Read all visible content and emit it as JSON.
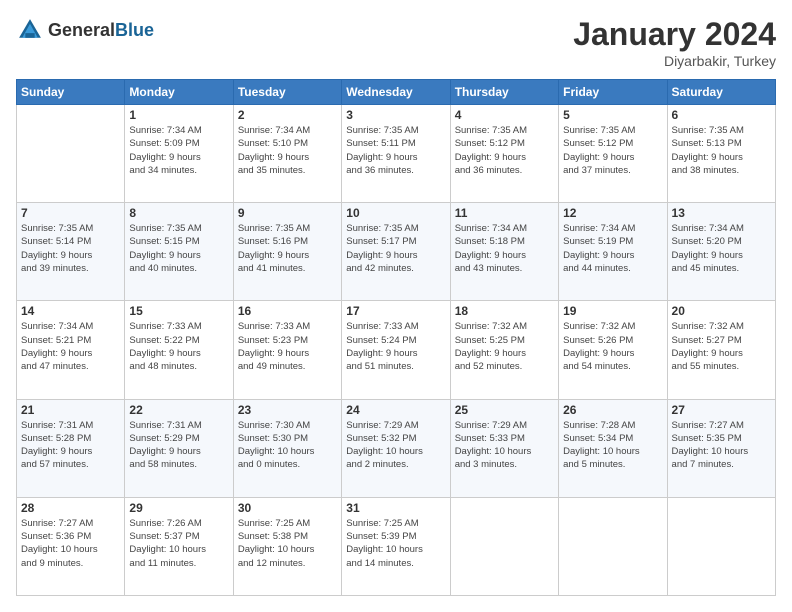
{
  "header": {
    "logo_general": "General",
    "logo_blue": "Blue",
    "month": "January 2024",
    "location": "Diyarbakir, Turkey"
  },
  "weekdays": [
    "Sunday",
    "Monday",
    "Tuesday",
    "Wednesday",
    "Thursday",
    "Friday",
    "Saturday"
  ],
  "weeks": [
    [
      {
        "day": "",
        "info": ""
      },
      {
        "day": "1",
        "info": "Sunrise: 7:34 AM\nSunset: 5:09 PM\nDaylight: 9 hours\nand 34 minutes."
      },
      {
        "day": "2",
        "info": "Sunrise: 7:34 AM\nSunset: 5:10 PM\nDaylight: 9 hours\nand 35 minutes."
      },
      {
        "day": "3",
        "info": "Sunrise: 7:35 AM\nSunset: 5:11 PM\nDaylight: 9 hours\nand 36 minutes."
      },
      {
        "day": "4",
        "info": "Sunrise: 7:35 AM\nSunset: 5:12 PM\nDaylight: 9 hours\nand 36 minutes."
      },
      {
        "day": "5",
        "info": "Sunrise: 7:35 AM\nSunset: 5:12 PM\nDaylight: 9 hours\nand 37 minutes."
      },
      {
        "day": "6",
        "info": "Sunrise: 7:35 AM\nSunset: 5:13 PM\nDaylight: 9 hours\nand 38 minutes."
      }
    ],
    [
      {
        "day": "7",
        "info": "Sunrise: 7:35 AM\nSunset: 5:14 PM\nDaylight: 9 hours\nand 39 minutes."
      },
      {
        "day": "8",
        "info": "Sunrise: 7:35 AM\nSunset: 5:15 PM\nDaylight: 9 hours\nand 40 minutes."
      },
      {
        "day": "9",
        "info": "Sunrise: 7:35 AM\nSunset: 5:16 PM\nDaylight: 9 hours\nand 41 minutes."
      },
      {
        "day": "10",
        "info": "Sunrise: 7:35 AM\nSunset: 5:17 PM\nDaylight: 9 hours\nand 42 minutes."
      },
      {
        "day": "11",
        "info": "Sunrise: 7:34 AM\nSunset: 5:18 PM\nDaylight: 9 hours\nand 43 minutes."
      },
      {
        "day": "12",
        "info": "Sunrise: 7:34 AM\nSunset: 5:19 PM\nDaylight: 9 hours\nand 44 minutes."
      },
      {
        "day": "13",
        "info": "Sunrise: 7:34 AM\nSunset: 5:20 PM\nDaylight: 9 hours\nand 45 minutes."
      }
    ],
    [
      {
        "day": "14",
        "info": "Sunrise: 7:34 AM\nSunset: 5:21 PM\nDaylight: 9 hours\nand 47 minutes."
      },
      {
        "day": "15",
        "info": "Sunrise: 7:33 AM\nSunset: 5:22 PM\nDaylight: 9 hours\nand 48 minutes."
      },
      {
        "day": "16",
        "info": "Sunrise: 7:33 AM\nSunset: 5:23 PM\nDaylight: 9 hours\nand 49 minutes."
      },
      {
        "day": "17",
        "info": "Sunrise: 7:33 AM\nSunset: 5:24 PM\nDaylight: 9 hours\nand 51 minutes."
      },
      {
        "day": "18",
        "info": "Sunrise: 7:32 AM\nSunset: 5:25 PM\nDaylight: 9 hours\nand 52 minutes."
      },
      {
        "day": "19",
        "info": "Sunrise: 7:32 AM\nSunset: 5:26 PM\nDaylight: 9 hours\nand 54 minutes."
      },
      {
        "day": "20",
        "info": "Sunrise: 7:32 AM\nSunset: 5:27 PM\nDaylight: 9 hours\nand 55 minutes."
      }
    ],
    [
      {
        "day": "21",
        "info": "Sunrise: 7:31 AM\nSunset: 5:28 PM\nDaylight: 9 hours\nand 57 minutes."
      },
      {
        "day": "22",
        "info": "Sunrise: 7:31 AM\nSunset: 5:29 PM\nDaylight: 9 hours\nand 58 minutes."
      },
      {
        "day": "23",
        "info": "Sunrise: 7:30 AM\nSunset: 5:30 PM\nDaylight: 10 hours\nand 0 minutes."
      },
      {
        "day": "24",
        "info": "Sunrise: 7:29 AM\nSunset: 5:32 PM\nDaylight: 10 hours\nand 2 minutes."
      },
      {
        "day": "25",
        "info": "Sunrise: 7:29 AM\nSunset: 5:33 PM\nDaylight: 10 hours\nand 3 minutes."
      },
      {
        "day": "26",
        "info": "Sunrise: 7:28 AM\nSunset: 5:34 PM\nDaylight: 10 hours\nand 5 minutes."
      },
      {
        "day": "27",
        "info": "Sunrise: 7:27 AM\nSunset: 5:35 PM\nDaylight: 10 hours\nand 7 minutes."
      }
    ],
    [
      {
        "day": "28",
        "info": "Sunrise: 7:27 AM\nSunset: 5:36 PM\nDaylight: 10 hours\nand 9 minutes."
      },
      {
        "day": "29",
        "info": "Sunrise: 7:26 AM\nSunset: 5:37 PM\nDaylight: 10 hours\nand 11 minutes."
      },
      {
        "day": "30",
        "info": "Sunrise: 7:25 AM\nSunset: 5:38 PM\nDaylight: 10 hours\nand 12 minutes."
      },
      {
        "day": "31",
        "info": "Sunrise: 7:25 AM\nSunset: 5:39 PM\nDaylight: 10 hours\nand 14 minutes."
      },
      {
        "day": "",
        "info": ""
      },
      {
        "day": "",
        "info": ""
      },
      {
        "day": "",
        "info": ""
      }
    ]
  ]
}
